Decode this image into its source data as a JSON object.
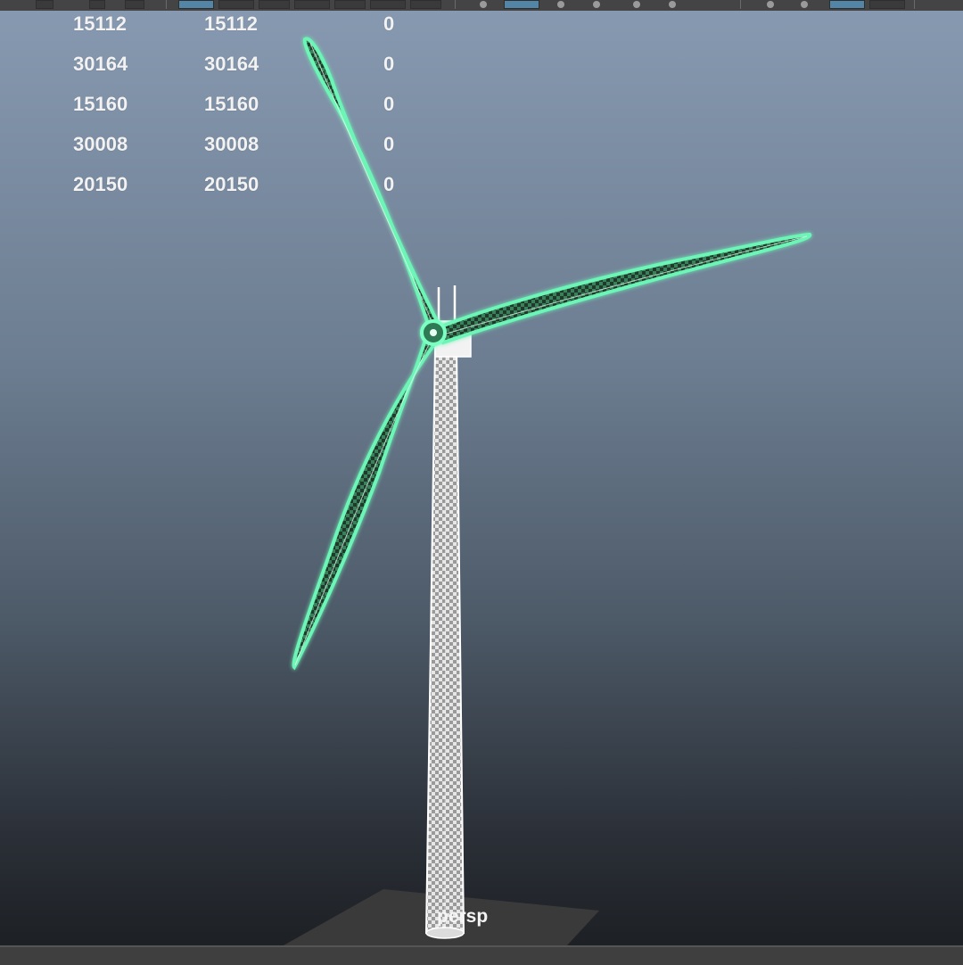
{
  "toolbar": {
    "icons": [
      "grid-icon",
      "snap-icon",
      "camera-icon",
      "wireframe-icon",
      "shaded-icon",
      "lighting-icon",
      "isolate-icon",
      "xray-icon"
    ]
  },
  "hud": {
    "rows": [
      {
        "col1": "15112",
        "col2": "15112",
        "col3": "0"
      },
      {
        "col1": "30164",
        "col2": "30164",
        "col3": "0"
      },
      {
        "col1": "15160",
        "col2": "15160",
        "col3": "0"
      },
      {
        "col1": "30008",
        "col2": "30008",
        "col3": "0"
      },
      {
        "col1": "20150",
        "col2": "20150",
        "col3": "0"
      }
    ]
  },
  "viewport": {
    "camera": "persp",
    "selection_color": "#4ee3a0",
    "mesh_color": "#ffffff"
  }
}
